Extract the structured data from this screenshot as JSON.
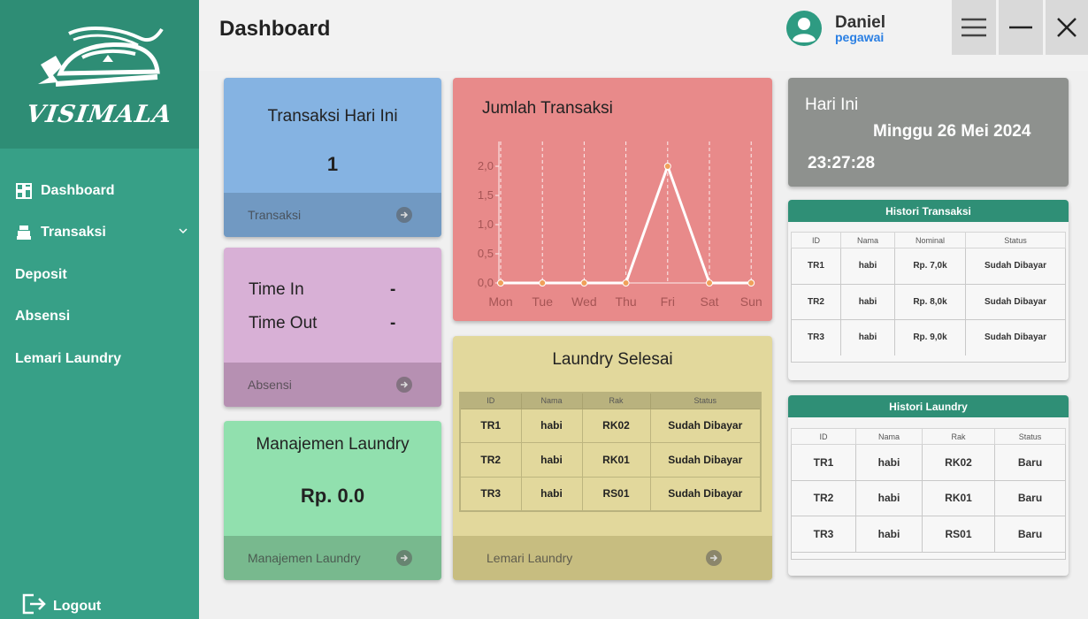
{
  "sidebar": {
    "brand": "VISIMALA",
    "items": [
      {
        "label": "Dashboard",
        "icon": "dashboard-icon"
      },
      {
        "label": "Transaksi",
        "icon": "cash-register-icon"
      },
      {
        "label": "Deposit"
      },
      {
        "label": "Absensi"
      },
      {
        "label": "Lemari Laundry"
      }
    ],
    "logout_label": "Logout"
  },
  "header": {
    "title": "Dashboard",
    "user_name": "Daniel",
    "user_role": "pegawai"
  },
  "cards": {
    "transaksi_hari_ini": {
      "title": "Transaksi Hari Ini",
      "value": "1",
      "footer": "Transaksi"
    },
    "absensi": {
      "time_in_label": "Time In",
      "time_in_value": "-",
      "time_out_label": "Time Out",
      "time_out_value": "-",
      "footer": "Absensi"
    },
    "manajemen": {
      "title": "Manajemen Laundry",
      "value": "Rp. 0.0",
      "footer": "Manajemen Laundry"
    },
    "jumlah_transaksi": {
      "title": "Jumlah Transaksi"
    },
    "laundry_selesai": {
      "title": "Laundry Selesai",
      "columns": [
        "ID",
        "Nama",
        "Rak",
        "Status"
      ],
      "rows": [
        [
          "TR1",
          "habi",
          "RK02",
          "Sudah Dibayar"
        ],
        [
          "TR2",
          "habi",
          "RK01",
          "Sudah Dibayar"
        ],
        [
          "TR3",
          "habi",
          "RS01",
          "Sudah Dibayar"
        ]
      ],
      "footer": "Lemari Laundry"
    },
    "hari_ini": {
      "label": "Hari Ini",
      "date": "Minggu 26 Mei 2024",
      "time": "23:27:28"
    },
    "histori_transaksi": {
      "title": "Histori Transaksi",
      "columns": [
        "ID",
        "Nama",
        "Nominal",
        "Status"
      ],
      "rows": [
        [
          "TR1",
          "habi",
          "Rp. 7,0k",
          "Sudah Dibayar"
        ],
        [
          "TR2",
          "habi",
          "Rp. 8,0k",
          "Sudah Dibayar"
        ],
        [
          "TR3",
          "habi",
          "Rp. 9,0k",
          "Sudah Dibayar"
        ]
      ]
    },
    "histori_laundry": {
      "title": "Histori Laundry",
      "columns": [
        "ID",
        "Nama",
        "Rak",
        "Status"
      ],
      "rows": [
        [
          "TR1",
          "habi",
          "RK02",
          "Baru"
        ],
        [
          "TR2",
          "habi",
          "RK01",
          "Baru"
        ],
        [
          "TR3",
          "habi",
          "RS01",
          "Baru"
        ]
      ]
    }
  },
  "chart_data": {
    "type": "line",
    "title": "Jumlah Transaksi",
    "categories": [
      "Mon",
      "Tue",
      "Wed",
      "Thu",
      "Fri",
      "Sat",
      "Sun"
    ],
    "values": [
      0,
      0,
      0,
      0,
      2,
      0,
      0
    ],
    "yticks": [
      "0,0",
      "0,5",
      "1,0",
      "1,5",
      "2,0"
    ],
    "ylim": [
      0,
      2.0
    ],
    "grid": true,
    "line_color": "#ffffff",
    "marker_color": "#f0a05a"
  }
}
